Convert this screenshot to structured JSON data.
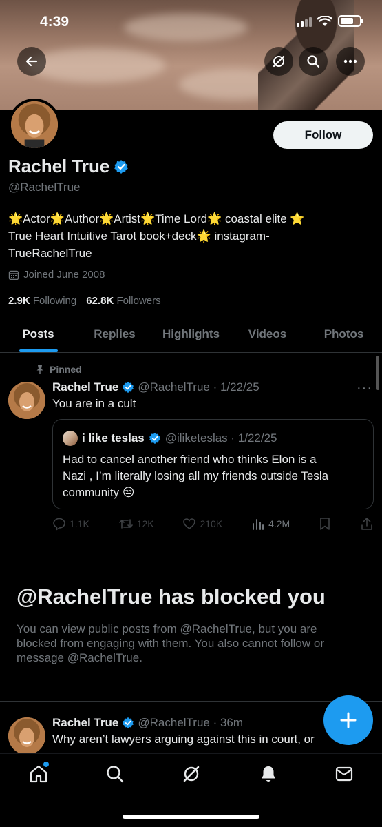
{
  "status_bar": {
    "time": "4:39"
  },
  "colors": {
    "accent": "#1d9bf0",
    "background": "#000000",
    "muted": "#71767b",
    "text": "#e7e9ea"
  },
  "header": {
    "icons": [
      "back-arrow-icon",
      "grok-icon",
      "search-icon",
      "more-icon"
    ]
  },
  "profile": {
    "name": "Rachel True",
    "handle": "@RachelTrue",
    "follow_label": "Follow",
    "bio_line1": "🌟Actor🌟Author🌟Artist🌟Time Lord🌟 coastal elite ⭐",
    "bio_line2": "True Heart Intuitive Tarot book+deck🌟 instagram-",
    "bio_line3": "TrueRachelTrue",
    "joined": "Joined June 2008",
    "following_count": "2.9K",
    "following_label": "Following",
    "followers_count": "62.8K",
    "followers_label": "Followers"
  },
  "tabs": [
    {
      "label": "Posts",
      "active": true
    },
    {
      "label": "Replies",
      "active": false
    },
    {
      "label": "Highlights",
      "active": false
    },
    {
      "label": "Videos",
      "active": false
    },
    {
      "label": "Photos",
      "active": false
    }
  ],
  "pinned_post": {
    "pinned_label": "Pinned",
    "author": "Rachel True",
    "meta": "@RachelTrue · 1/22/25",
    "text": "You are in a cult",
    "more": "···",
    "quote": {
      "author": "i like teslas",
      "meta": "@iliketeslas · 1/22/25",
      "line1": "Had to cancel another friend who thinks Elon is a",
      "line2": "Nazi , I’m literally losing all my friends outside Tesla",
      "line3": "community 😒"
    },
    "actions": {
      "replies": "1.1K",
      "reposts": "12K",
      "likes": "210K",
      "views": "4.2M"
    }
  },
  "blocked": {
    "title": "@RachelTrue has blocked you",
    "line1": "You can view public posts from @RachelTrue, but you are",
    "line2": "blocked from engaging with them. You also cannot follow or",
    "line3": "message @RachelTrue."
  },
  "second_post": {
    "author": "Rachel True",
    "meta": "@RachelTrue · 36m",
    "text": "Why aren’t lawyers arguing against this in court, or"
  },
  "fab_label": "+",
  "bottom_nav": [
    "home-icon",
    "search-icon",
    "grok-icon",
    "notifications-icon",
    "messages-icon"
  ]
}
